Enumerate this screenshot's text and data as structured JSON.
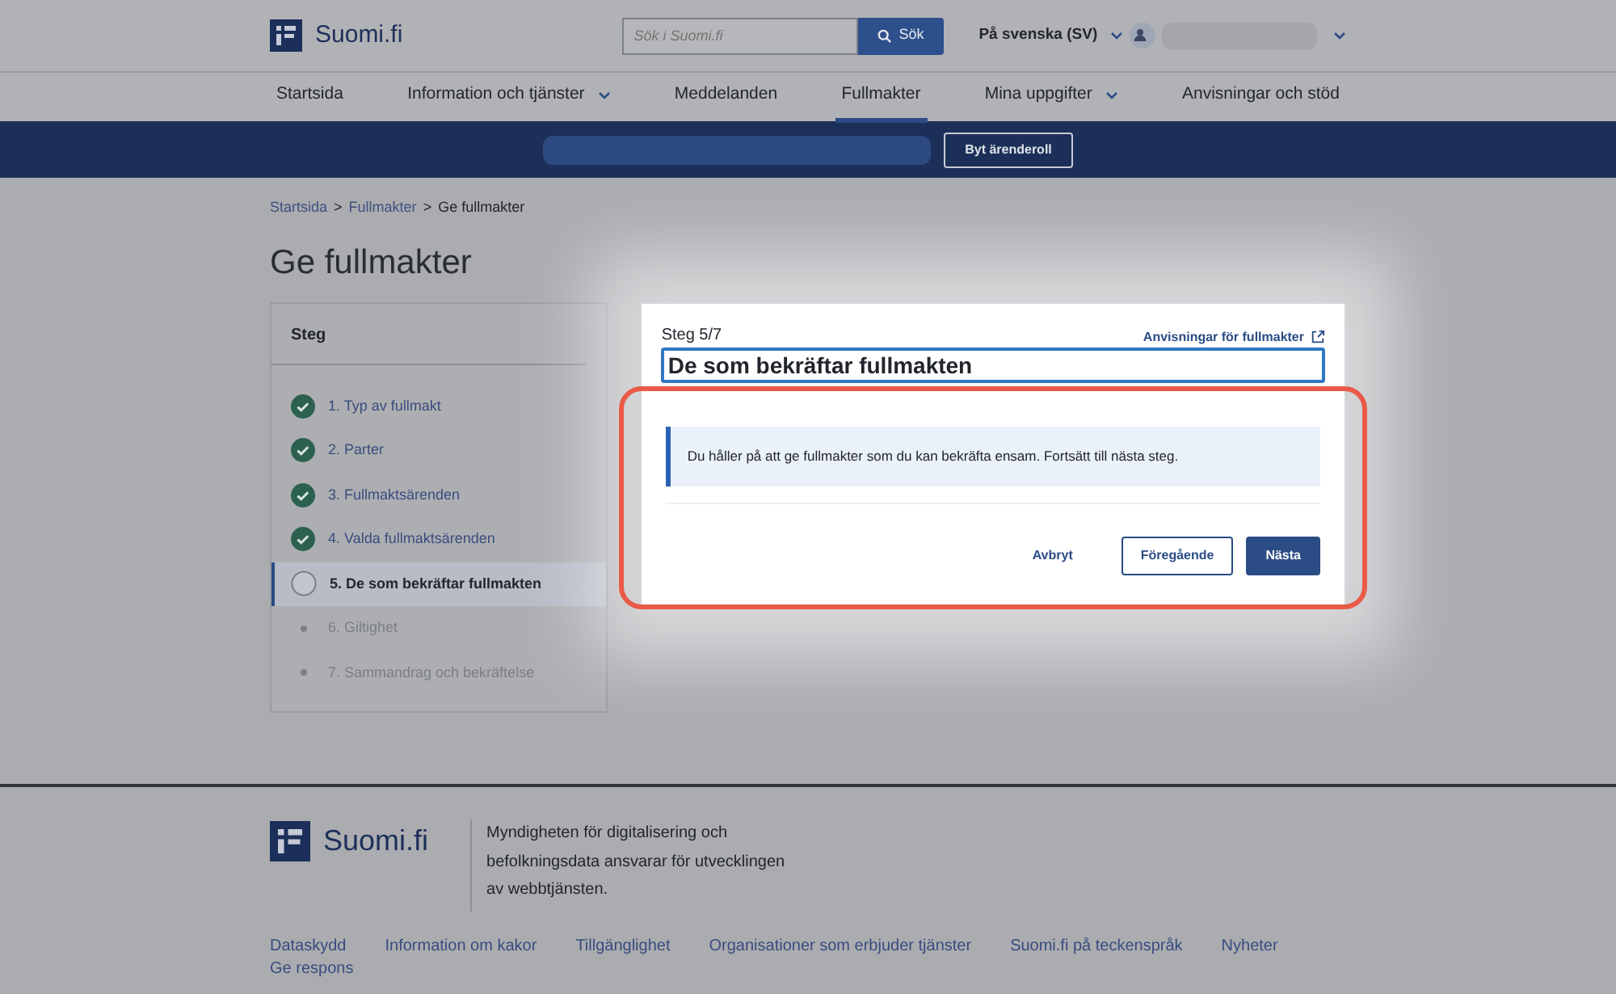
{
  "header": {
    "logo_text": "Suomi.fi",
    "search": {
      "placeholder": "Sök i Suomi.fi",
      "button": "Sök"
    },
    "language": "På svenska (SV)"
  },
  "nav": [
    {
      "label": "Startsida",
      "selected": false,
      "dropdown": false
    },
    {
      "label": "Information och tjänster",
      "selected": false,
      "dropdown": true
    },
    {
      "label": "Meddelanden",
      "selected": false,
      "dropdown": false
    },
    {
      "label": "Fullmakter",
      "selected": true,
      "dropdown": false
    },
    {
      "label": "Mina uppgifter",
      "selected": false,
      "dropdown": true
    },
    {
      "label": "Anvisningar och stöd",
      "selected": false,
      "dropdown": false
    }
  ],
  "role_bar": {
    "button": "Byt ärenderoll"
  },
  "breadcrumb": [
    {
      "label": "Startsida",
      "kind": "link"
    },
    {
      "label": ">",
      "kind": "separator"
    },
    {
      "label": "Fullmakter",
      "kind": "link"
    },
    {
      "label": ">",
      "kind": "separator"
    },
    {
      "label": "Ge fullmakter",
      "kind": "current"
    }
  ],
  "title": "Ge fullmakter",
  "steps": {
    "heading": "Steg",
    "items": [
      {
        "label": "1. Typ av fullmakt",
        "kind": "done"
      },
      {
        "label": "2. Parter",
        "kind": "done"
      },
      {
        "label": "3. Fullmaktsärenden",
        "kind": "done"
      },
      {
        "label": "4. Valda fullmaktsärenden",
        "kind": "done"
      },
      {
        "label": "5. De som bekräftar fullmakten",
        "kind": "current"
      },
      {
        "label": "6. Giltighet",
        "kind": "pending"
      },
      {
        "label": "7. Sammandrag och bekräftelse",
        "kind": "pending"
      }
    ]
  },
  "panel": {
    "counter": "Steg 5/7",
    "help_link": "Anvisningar för fullmakter",
    "heading": "De som bekräftar fullmakten",
    "info": "Du håller på att ge fullmakter som du kan bekräfta ensam. Fortsätt till nästa steg.",
    "buttons": [
      {
        "label": "Avbryt",
        "kind": "link"
      },
      {
        "label": "Föregående",
        "kind": "outline"
      },
      {
        "label": "Nästa",
        "kind": "primary"
      }
    ]
  },
  "footer": {
    "logo_text": "Suomi.fi",
    "description": "Myndigheten för digitalisering och befolkningsdata ansvarar för utvecklingen av webbtjänsten.",
    "links": [
      "Dataskydd",
      "Information om kakor",
      "Tillgänglighet",
      "Organisationer som erbjuder tjänster",
      "Suomi.fi på teckenspråk",
      "Nyheter",
      "Ge respons"
    ]
  }
}
